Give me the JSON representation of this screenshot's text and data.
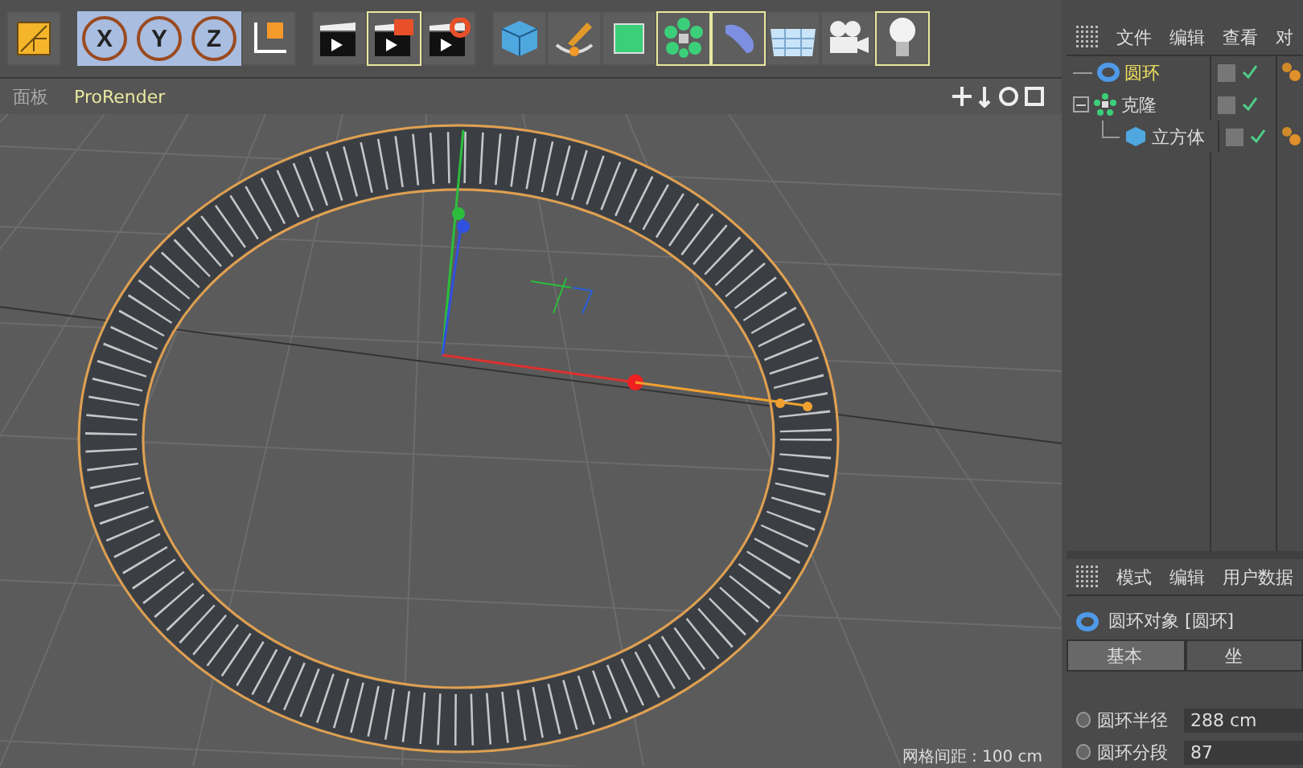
{
  "toolbar": [
    {
      "items": [
        {
          "kind": "snap",
          "selected": false
        }
      ]
    },
    {
      "items": [
        {
          "kind": "axis",
          "label": "X",
          "selected": true
        },
        {
          "kind": "axis",
          "label": "Y",
          "selected": true
        },
        {
          "kind": "axis",
          "label": "Z",
          "selected": true
        },
        {
          "kind": "coords",
          "selected": false
        }
      ]
    },
    {
      "items": [
        {
          "kind": "render",
          "selected": false
        },
        {
          "kind": "render-view",
          "selected": true
        },
        {
          "kind": "render-settings",
          "selected": false
        }
      ]
    },
    {
      "items": [
        {
          "kind": "cube",
          "selected": false
        },
        {
          "kind": "pen",
          "selected": false
        },
        {
          "kind": "subdivision",
          "selected": false
        },
        {
          "kind": "cloner",
          "selected": true
        },
        {
          "kind": "deformer",
          "selected": true
        },
        {
          "kind": "floor",
          "selected": false
        },
        {
          "kind": "camera",
          "selected": false
        },
        {
          "kind": "light",
          "selected": true
        }
      ]
    }
  ],
  "viewport": {
    "menu": [
      "面板",
      "ProRender"
    ],
    "grid_spacing": "网格间距 : 100 cm"
  },
  "object_manager": {
    "menu": [
      "文件",
      "编辑",
      "查看",
      "对"
    ],
    "objects": [
      {
        "name": "圆环",
        "kind": "torus",
        "selected": true,
        "enabled": true,
        "tagged": true
      },
      {
        "name": "克隆",
        "kind": "cloner",
        "selected": false,
        "enabled": true,
        "expanded": true,
        "children": [
          {
            "name": "立方体",
            "kind": "cube",
            "selected": false,
            "enabled": true,
            "tagged": true
          }
        ]
      }
    ]
  },
  "attribute_manager": {
    "menu": [
      "模式",
      "编辑",
      "用户数据"
    ],
    "title": "圆环对象 [圆环]",
    "tabs": [
      {
        "label": "基本",
        "selected": true
      },
      {
        "label": "坐",
        "selected": false
      }
    ],
    "fields": [
      {
        "label": "圆环半径",
        "value": "288 cm",
        "animated": false
      },
      {
        "label": "圆环分段",
        "value": "87",
        "animated": false
      }
    ]
  }
}
